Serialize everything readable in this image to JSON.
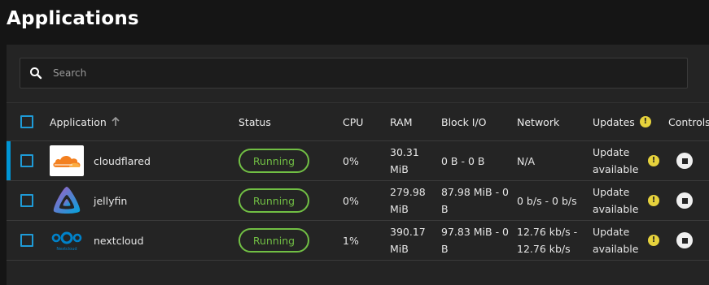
{
  "page": {
    "title": "Applications"
  },
  "search": {
    "placeholder": "Search",
    "value": ""
  },
  "table": {
    "headers": {
      "application": "Application",
      "status": "Status",
      "cpu": "CPU",
      "ram": "RAM",
      "block_io": "Block I/O",
      "network": "Network",
      "updates": "Updates",
      "controls": "Controls"
    },
    "rows": [
      {
        "name": "cloudflared",
        "status": "Running",
        "cpu": "0%",
        "ram_line1": "30.31",
        "ram_line2": "MiB",
        "block_io_line1": "0 B - 0 B",
        "block_io_line2": "",
        "network_line1": "N/A",
        "network_line2": "",
        "update_line1": "Update",
        "update_line2": "available"
      },
      {
        "name": "jellyfin",
        "status": "Running",
        "cpu": "0%",
        "ram_line1": "279.98",
        "ram_line2": "MiB",
        "block_io_line1": "87.98 MiB - 0",
        "block_io_line2": "B",
        "network_line1": "0 b/s - 0 b/s",
        "network_line2": "",
        "update_line1": "Update",
        "update_line2": "available"
      },
      {
        "name": "nextcloud",
        "status": "Running",
        "cpu": "1%",
        "ram_line1": "390.17",
        "ram_line2": "MiB",
        "block_io_line1": "97.83 MiB - 0",
        "block_io_line2": "B",
        "network_line1": "12.76 kb/s -",
        "network_line2": "12.76 kb/s",
        "update_line1": "Update",
        "update_line2": "available"
      }
    ]
  },
  "colors": {
    "accent": "#0095d5",
    "running": "#71bf44",
    "warning": "#e6d23c",
    "panel": "#242424",
    "background": "#151515"
  }
}
